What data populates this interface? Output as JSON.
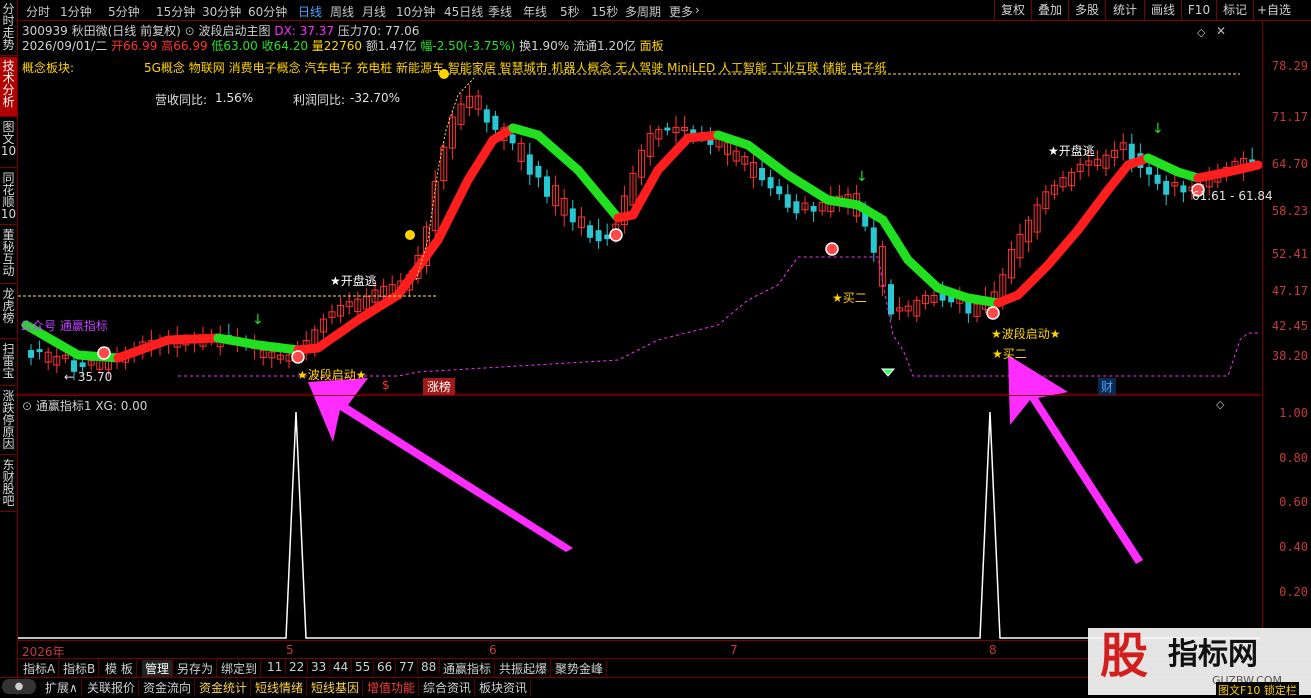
{
  "sidebar": {
    "tabs": [
      {
        "label": "分时走势",
        "active": false
      },
      {
        "label": "技术分析",
        "active": true
      },
      {
        "label": "图文10",
        "active": false
      },
      {
        "label": "同花顺10",
        "active": false
      },
      {
        "label": "董秘互动",
        "active": false
      },
      {
        "label": "龙虎榜",
        "active": false
      },
      {
        "label": "扫雷宝",
        "active": false
      },
      {
        "label": "涨跌停原因",
        "active": false
      },
      {
        "label": "东财股吧",
        "active": false
      }
    ]
  },
  "topbar": {
    "periods": [
      "分时",
      "1分钟",
      "5分钟",
      "15分钟",
      "30分钟",
      "60分钟",
      "日线",
      "周线",
      "月线",
      "10分钟",
      "45日线",
      "季线",
      "年线",
      "5秒",
      "15秒",
      "多周期",
      "更多"
    ],
    "active_period": "日线",
    "right_buttons": [
      "复权",
      "叠加",
      "多股",
      "统计",
      "画线",
      "F10",
      "标记",
      "+自选"
    ],
    "dropdown_icon": "chevron-right-icon"
  },
  "info": {
    "line1_code_name": "300939 秋田微(日线 前复权)",
    "line1_indicator": "波段启动主图",
    "line1_dx": "DX: 37.37",
    "line1_pressure": "压力70: 77.06",
    "line2_date": "2026/09/01/二",
    "line2_open": "开66.99",
    "line2_high": "高66.99",
    "line2_low": "低63.00",
    "line2_close": "收64.20",
    "line2_vol": "量22760",
    "line2_amount": "额1.47亿",
    "line2_change": "幅-2.50(-3.75%)",
    "line2_turnover": "换1.90%",
    "line2_float": "流通1.20亿",
    "line2_board": "面板",
    "concept_label": "概念板块:",
    "concepts": "5G概念 物联网 消费电子概念 汽车电子 充电桩 新能源车 智能家居 智慧城市 机器人概念 无人驾驶 MiniLED 人工智能 工业互联 储能 电子纸",
    "revenue_label": "营收同比:",
    "revenue_value": "1.56%",
    "profit_label": "利润同比:",
    "profit_value": "-32.70%"
  },
  "main_axis": [
    "78.29",
    "71.17",
    "64.70",
    "58.23",
    "52.41",
    "47.17",
    "42.45",
    "38.20"
  ],
  "annotations": {
    "kaipan1": "★开盘逃",
    "kaipan2": "★开盘逃",
    "boduan1": "★波段启动★",
    "boduan2": "★波段启动★",
    "maier1": "★买二",
    "maier2": "★买二",
    "low_price": "← 35.70",
    "range": "61.61 - 61.84",
    "gzh": "公众号 通赢指标",
    "zhangbang": "涨榜",
    "cai": "财",
    "dollar": "$"
  },
  "sub_panel": {
    "title": "通赢指标1  XG: 0.00",
    "axis": [
      "1.00",
      "0.80",
      "0.60",
      "0.40",
      "0.20"
    ]
  },
  "dates": [
    "2026年",
    "5",
    "6",
    "7",
    "8"
  ],
  "bottom1": {
    "tabs": [
      "指标A",
      "指标B",
      "模 板",
      "管理",
      "另存为",
      "绑定到",
      "11",
      "22",
      "33",
      "44",
      "55",
      "66",
      "77",
      "88",
      "通赢指标",
      "共振起爆",
      "聚势金峰"
    ],
    "active": "管理"
  },
  "bottom2": {
    "items": [
      "扩展∧",
      "关联报价",
      "资金流向",
      "资金统计",
      "短线情绪",
      "短线基因",
      "增值功能",
      "综合资讯",
      "板块资讯"
    ],
    "gold": [
      "资金统计",
      "短线情绪",
      "短线基因"
    ],
    "red": [
      "增值功能"
    ]
  },
  "watermark": {
    "big": "股",
    "text": "指标网",
    "url": "GUZBW.COM",
    "corner": "图文F10 锁定栏"
  },
  "colors": {
    "up": "#ff3232",
    "down": "#28c8d2",
    "line_up": "#ff1e1e",
    "line_down": "#20e020",
    "magenta": "#ff2cff",
    "gold": "#ffd400",
    "axis": "#c43a3a",
    "border": "#7a0000"
  }
}
